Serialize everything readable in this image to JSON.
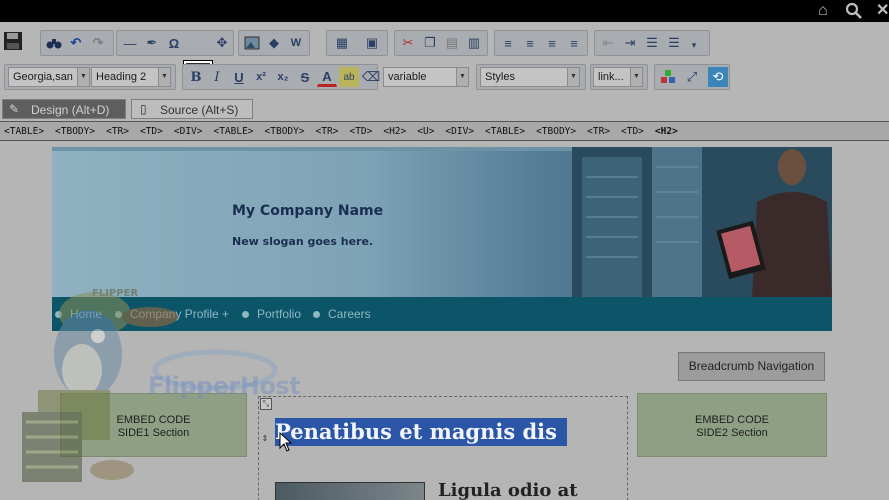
{
  "topbar": {
    "icons": [
      "home-icon",
      "search-icon",
      "close-icon"
    ]
  },
  "toolbar": {
    "font_family": "Georgia,san",
    "block_format": "Heading 2",
    "font_size": "variable",
    "styles": "Styles",
    "link": "link..."
  },
  "tabs": [
    {
      "label": "Design (Alt+D)",
      "active": true
    },
    {
      "label": "Source (Alt+S)",
      "active": false
    }
  ],
  "tag_path": [
    "<TABLE>",
    "<TBODY>",
    "<TR>",
    "<TD>",
    "<DIV>",
    "<TABLE>",
    "<TBODY>",
    "<TR>",
    "<TD>",
    "<H2>",
    "<U>",
    "<DIV>",
    "<TABLE>",
    "<TBODY>",
    "<TR>",
    "<TD>",
    "<H2>"
  ],
  "page": {
    "company_name": "My Company Name",
    "slogan": "New slogan goes here.",
    "nav": [
      "Home",
      "Company Profile +",
      "Portfolio",
      "Careers"
    ],
    "breadcrumb_button": "Breadcrumb Navigation",
    "embed_left_line1": "EMBED CODE",
    "embed_left_line2": "SIDE1 Section",
    "embed_right_line1": "EMBED CODE",
    "embed_right_line2": "SIDE2 Section",
    "selected_heading": "Penatibus et magnis dis",
    "sub_heading": "Ligula odio at"
  },
  "overlay": {
    "mascot_label": "FLIPPER",
    "brand": "FlipperHost"
  }
}
